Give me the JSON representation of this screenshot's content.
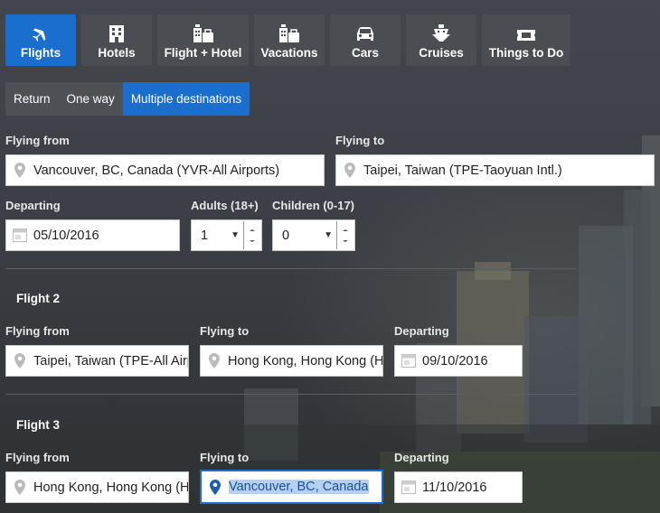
{
  "tabs": [
    {
      "label": "Flights",
      "icon": "plane-icon",
      "active": true
    },
    {
      "label": "Hotels",
      "icon": "hotel-icon",
      "active": false
    },
    {
      "label": "Flight + Hotel",
      "icon": "flight-hotel-icon",
      "active": false
    },
    {
      "label": "Vacations",
      "icon": "vacation-icon",
      "active": false
    },
    {
      "label": "Cars",
      "icon": "car-icon",
      "active": false
    },
    {
      "label": "Cruises",
      "icon": "cruise-icon",
      "active": false
    },
    {
      "label": "Things to Do",
      "icon": "ticket-icon",
      "active": false
    }
  ],
  "trip_type": {
    "options": [
      "Return",
      "One way",
      "Multiple destinations"
    ],
    "selected": "Multiple destinations"
  },
  "flight1": {
    "from_label": "Flying from",
    "from_value": "Vancouver, BC, Canada (YVR-All Airports)",
    "to_label": "Flying to",
    "to_value": "Taipei, Taiwan (TPE-Taoyuan Intl.)",
    "departing_label": "Departing",
    "departing_value": "05/10/2016",
    "adults_label": "Adults (18+)",
    "adults_value": "1",
    "children_label": "Children (0-17)",
    "children_value": "0"
  },
  "flight2": {
    "title": "Flight 2",
    "from_label": "Flying from",
    "from_value": "Taipei, Taiwan (TPE-All Airports)",
    "to_label": "Flying to",
    "to_value": "Hong Kong, Hong Kong (HKG)",
    "departing_label": "Departing",
    "departing_value": "09/10/2016"
  },
  "flight3": {
    "title": "Flight 3",
    "from_label": "Flying from",
    "from_value": "Hong Kong, Hong Kong (HKG)",
    "to_label": "Flying to",
    "to_value": "Vancouver, BC, Canada",
    "departing_label": "Departing",
    "departing_value": "11/10/2016"
  },
  "colors": {
    "accent": "#1a6fce",
    "tab_bg": "#4a4d52",
    "focus_icon": "#1a5fb0"
  }
}
